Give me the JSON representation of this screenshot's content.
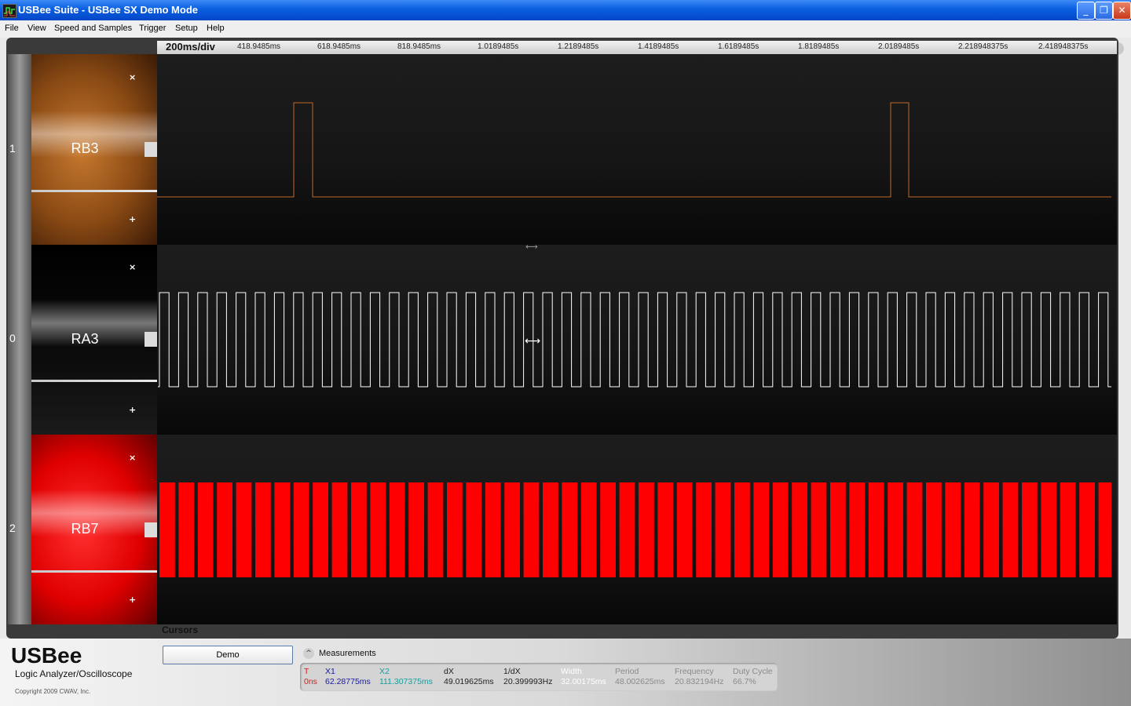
{
  "window": {
    "title": "USBee Suite - USBee SX Demo Mode",
    "app_icon": "waveform-app-icon",
    "minimize_glyph": "_",
    "maximize_glyph": "❐",
    "close_glyph": "✕"
  },
  "menu": [
    "File",
    "View",
    "Speed and Samples",
    "Trigger",
    "Setup",
    "Help"
  ],
  "scroll": {
    "left_glyph": "‹"
  },
  "timebar": {
    "timebase": "200ms/div",
    "ticks": [
      "418.9485ms",
      "618.9485ms",
      "818.9485ms",
      "1.0189485s",
      "1.2189485s",
      "1.4189485s",
      "1.6189485s",
      "1.8189485s",
      "2.0189485s",
      "2.218948375s",
      "2.418948375s"
    ]
  },
  "channels": [
    {
      "number": "1",
      "name": "RB3",
      "color": "#b85a1a",
      "minus": "×",
      "plus": "+"
    },
    {
      "number": "0",
      "name": "RA3",
      "color": "#000000",
      "minus": "×",
      "plus": "+"
    },
    {
      "number": "2",
      "name": "RB7",
      "color": "#ff0000",
      "minus": "×",
      "plus": "+"
    }
  ],
  "cursor_glyph": "⟷",
  "split_glyph": "⟷",
  "cursors": {
    "label": "Cursors",
    "demo_button": "Demo"
  },
  "brand": {
    "logo": "USBee",
    "subtitle": "Logic Analyzer/Oscilloscope",
    "copyright": "Copyright 2009 CWAV, Inc."
  },
  "measurements": {
    "title": "Measurements",
    "toggle_glyph": "^",
    "columns": [
      {
        "label": "T",
        "value": "0ns",
        "color": "#cc2222"
      },
      {
        "label": "X1",
        "value": "62.28775ms",
        "color": "#1a1aa0"
      },
      {
        "label": "X2",
        "value": "111.307375ms",
        "color": "#1a9c9c"
      },
      {
        "label": "dX",
        "value": "49.019625ms",
        "color": "#222222"
      },
      {
        "label": "1/dX",
        "value": "20.399993Hz",
        "color": "#222222"
      },
      {
        "label": "Width",
        "value": "32.00175ms",
        "color": "#ffffff"
      },
      {
        "label": "Period",
        "value": "48.002625ms",
        "color": "#8a8a8a"
      },
      {
        "label": "Frequency",
        "value": "20.832194Hz",
        "color": "#8a8a8a"
      },
      {
        "label": "Duty Cycle",
        "value": "66.7%",
        "color": "#8a8a8a"
      }
    ]
  }
}
